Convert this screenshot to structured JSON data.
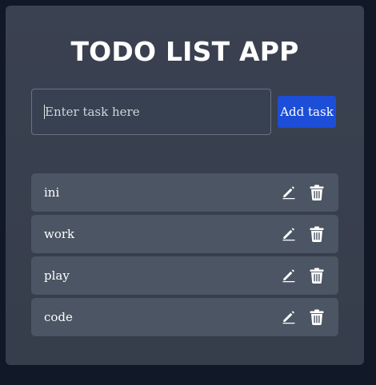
{
  "app": {
    "title": "TODO LIST APP"
  },
  "form": {
    "input_placeholder": "Enter task here",
    "input_value": "",
    "add_button_label": "Add task"
  },
  "tasks": [
    {
      "label": "ini",
      "edit_icon": "pencil-icon",
      "delete_icon": "trash-icon"
    },
    {
      "label": "work",
      "edit_icon": "pencil-icon",
      "delete_icon": "trash-icon"
    },
    {
      "label": "play",
      "edit_icon": "pencil-icon",
      "delete_icon": "trash-icon"
    },
    {
      "label": "code",
      "edit_icon": "pencil-icon",
      "delete_icon": "trash-icon"
    }
  ],
  "colors": {
    "page_background": "#111827",
    "card_background": "#374151",
    "task_background": "#4b5563",
    "accent": "#1d4ed8",
    "text": "#ffffff"
  }
}
